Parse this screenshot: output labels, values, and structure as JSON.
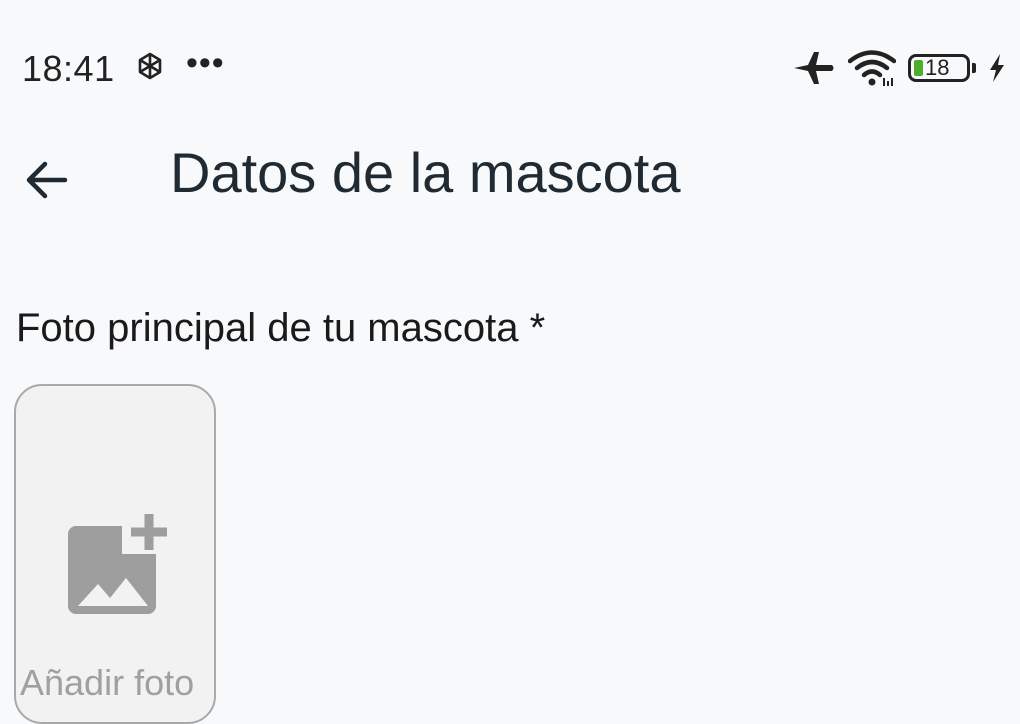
{
  "status_bar": {
    "time": "18:41",
    "more_indicator": "•••",
    "battery_level": "18",
    "battery_fraction": 0.18,
    "icons": [
      "chatgpt-icon",
      "airplane-mode-icon",
      "wifi-icon",
      "battery-icon",
      "charging-bolt-icon"
    ]
  },
  "app_bar": {
    "back_icon": "arrow-left-icon",
    "title": "Datos de la mascota"
  },
  "form": {
    "photo_label": "Foto principal de tu mascota *",
    "add_photo_label": "Añadir foto",
    "add_photo_icon": "add-photo-icon"
  },
  "colors": {
    "background": "#f8f9fb",
    "battery_fill": "#4caf2b",
    "card_border": "#a9a9a9",
    "card_bg": "#f2f2f2",
    "icon_gray": "#9e9e9e"
  }
}
